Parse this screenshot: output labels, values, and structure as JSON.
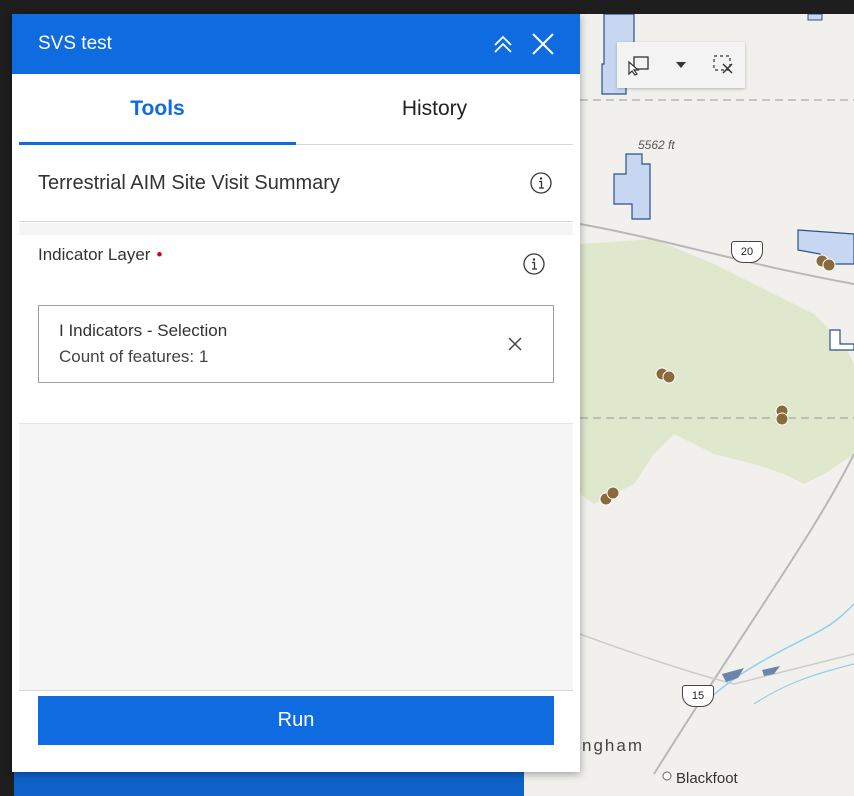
{
  "panel": {
    "title": "SVS test",
    "tabs": [
      {
        "label": "Tools",
        "active": true
      },
      {
        "label": "History",
        "active": false
      }
    ],
    "tool_name": "Terrestrial AIM Site Visit Summary",
    "parameter": {
      "label": "Indicator Layer",
      "required_marker": "•",
      "layer_name": "I Indicators - Selection",
      "feature_count": "Count of features: 1"
    },
    "run_label": "Run"
  },
  "map": {
    "labels": {
      "elevation": "5562 ft",
      "town_partial": "ngham",
      "town": "Blackfoot"
    },
    "highways": [
      "20",
      "15"
    ]
  },
  "icons": {
    "collapse": "double-chevron-up-icon",
    "close": "close-icon",
    "info": "info-icon",
    "clear": "close-icon",
    "select": "select-rectangle-icon",
    "dropdown": "caret-down-icon",
    "clear_selection": "clear-selection-icon"
  },
  "colors": {
    "accent": "#0e6ce0",
    "required": "#d0021b",
    "vegetation": "#dfe7cd",
    "parcel_fill": "#c7d7f2",
    "point": "#8a6a3c"
  }
}
